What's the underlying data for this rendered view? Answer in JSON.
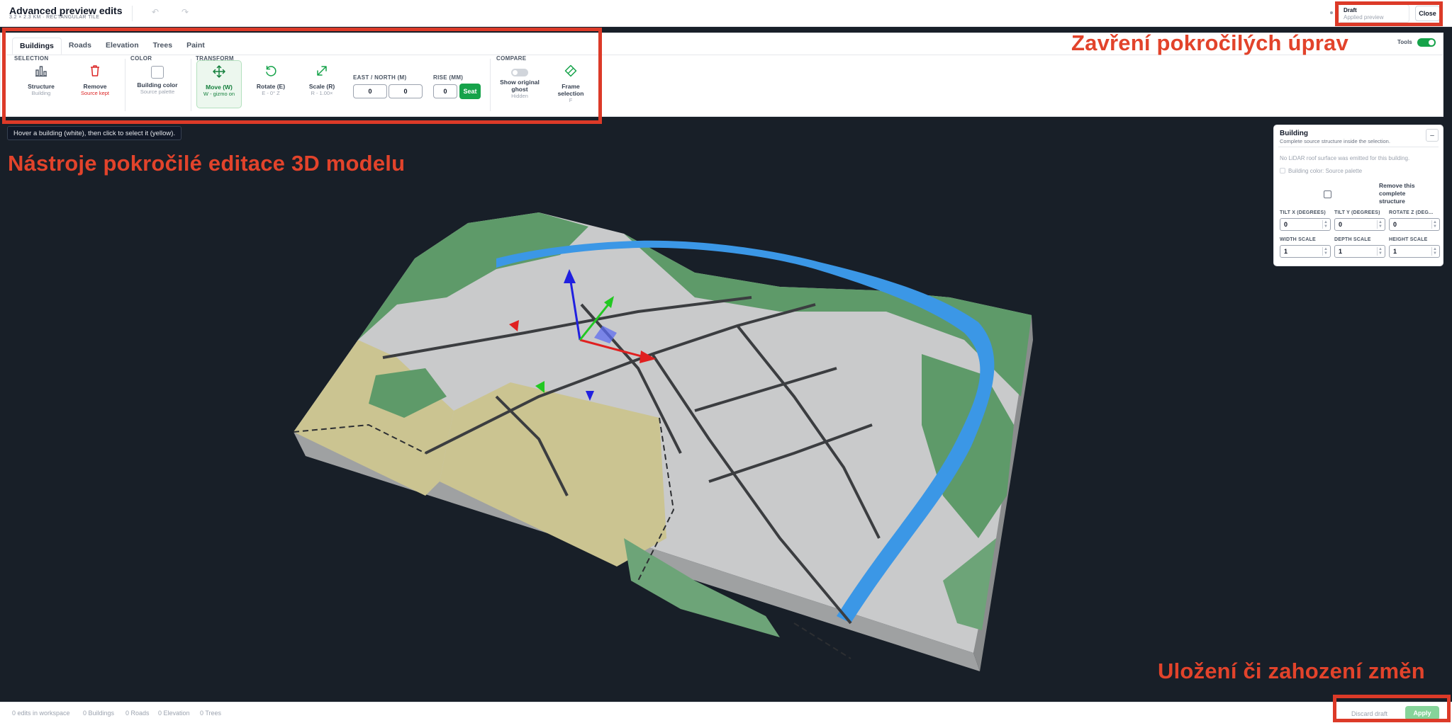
{
  "header": {
    "title": "Advanced preview edits",
    "subtitle": "3.2 × 2.3 KM · RECTANGULAR TILE",
    "undo_icon": "↶",
    "redo_icon": "↷",
    "draft_title": "Draft",
    "draft_sub": "Applied preview",
    "close_label": "Close"
  },
  "tabs": [
    "Buildings",
    "Roads",
    "Elevation",
    "Trees",
    "Paint"
  ],
  "tools_toggle": {
    "label": "Tools",
    "on": true
  },
  "sections": {
    "selection": "SELECTION",
    "color": "COLOR",
    "transform": "TRANSFORM",
    "compare": "COMPARE"
  },
  "tools": {
    "structure": {
      "label": "Structure",
      "sub": "Building",
      "icon": "bar-chart-icon"
    },
    "remove": {
      "label": "Remove",
      "sub": "Source kept",
      "icon": "trash-icon"
    },
    "building_color": {
      "label": "Building color",
      "sub": "Source palette"
    },
    "move": {
      "label": "Move (W)",
      "sub": "W - gizmo on",
      "icon": "move-arrows-icon"
    },
    "rotate": {
      "label": "Rotate (E)",
      "sub": "E - 0° Z",
      "icon": "rotate-icon"
    },
    "scale": {
      "label": "Scale (R)",
      "sub": "R - 1.00×",
      "icon": "scale-arrow-icon"
    },
    "ghost": {
      "label": "Show original ghost",
      "sub": "Hidden"
    },
    "frame": {
      "label": "Frame selection",
      "sub": "F",
      "icon": "frame-icon"
    }
  },
  "position": {
    "east_north_label": "EAST / NORTH (M)",
    "east": "0",
    "north": "0",
    "rise_label": "RISE (MM)",
    "rise": "0",
    "seat_label": "Seat"
  },
  "hint": "Hover a building (white), then click to select it (yellow).",
  "annotations": {
    "close": "Zavření pokročilých úprav",
    "tools": "Nástroje pokročilé editace 3D modelu",
    "save": "Uložení či zahození změn"
  },
  "building_panel": {
    "title": "Building",
    "subtitle": "Complete source structure inside the selection.",
    "collapse_label": "–",
    "note": "No LiDAR roof surface was emitted for this building.",
    "color_check": "Building color: Source palette",
    "remove_label": "Remove this complete structure",
    "fields": [
      {
        "label": "TILT X (DEGREES)",
        "value": "0"
      },
      {
        "label": "TILT Y (DEGREES)",
        "value": "0"
      },
      {
        "label": "ROTATE Z (DEG...",
        "value": "0"
      },
      {
        "label": "WIDTH SCALE",
        "value": "1"
      },
      {
        "label": "DEPTH SCALE",
        "value": "1"
      },
      {
        "label": "HEIGHT SCALE",
        "value": "1"
      }
    ]
  },
  "footer": {
    "edits": "0 edits in workspace",
    "buildings": "0 Buildings",
    "roads": "0 Roads",
    "elevation": "0 Elevation",
    "trees": "0 Trees",
    "discard_label": "Discard draft",
    "apply_label": "Apply"
  },
  "colors": {
    "accent": "#16a34a",
    "annotation": "#dc3a28",
    "viewport_bg": "#181f28",
    "water": "#3b97e6",
    "vegetation": "#5e9a69",
    "farmland": "#cbc491",
    "built_area": "#c9cacb"
  }
}
